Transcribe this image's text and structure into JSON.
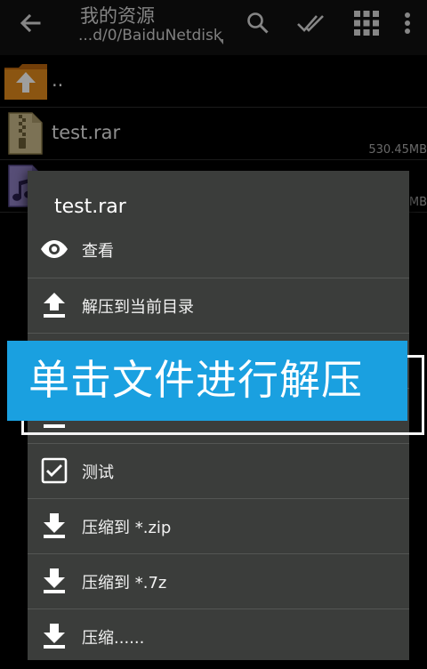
{
  "toolbar": {
    "title": "我的资源",
    "path": "...d/0/BaiduNetdisk",
    "icons": [
      "back-arrow-icon",
      "search-icon",
      "double-check-icon",
      "grid-icon",
      "overflow-menu-icon"
    ]
  },
  "files": [
    {
      "name": "..",
      "size": "",
      "icon": "folder-up-icon"
    },
    {
      "name": "test.rar",
      "size": "530.45MB",
      "icon": "archive-file-icon"
    },
    {
      "name": "",
      "size": "MB",
      "icon": "music-file-icon"
    }
  ],
  "menu": {
    "title": "test.rar",
    "items": [
      {
        "label": "查看",
        "icon": "eye-icon"
      },
      {
        "label": "解压到当前目录",
        "icon": "upload-icon"
      },
      {
        "label": "",
        "icon": "upload-icon"
      },
      {
        "label": "",
        "icon": "upload-icon"
      },
      {
        "label": "测试",
        "icon": "checkbox-icon"
      },
      {
        "label": "压缩到 *.zip",
        "icon": "download-icon"
      },
      {
        "label": "压缩到 *.7z",
        "icon": "download-icon"
      },
      {
        "label": "压缩......",
        "icon": "download-icon"
      }
    ]
  },
  "caption": {
    "text": "单击文件进行解压"
  },
  "colors": {
    "banner": "#1aa0e0",
    "menu_bg": "#3b3d3b",
    "folder": "#e08a1c"
  }
}
